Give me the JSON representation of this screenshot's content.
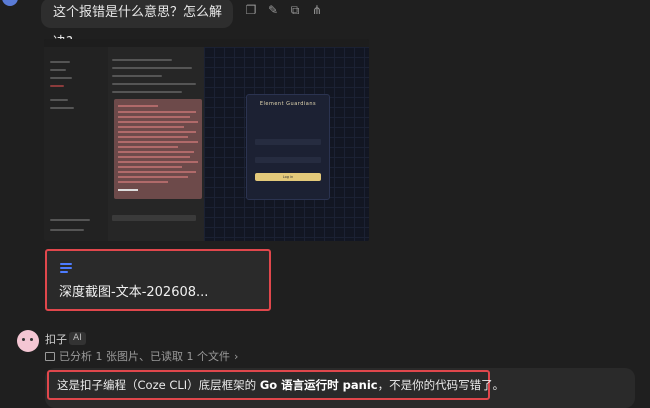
{
  "user_message": {
    "text": "这个报错是什么意思？怎么解决?"
  },
  "message_actions": [
    "bookmark-icon",
    "edit-icon",
    "copy-icon",
    "share-icon"
  ],
  "attachment": {
    "screenshot": {
      "login_title": "Element Guardians",
      "login_button": "Log in"
    },
    "file": {
      "name": "深度截图-文本-202608..."
    }
  },
  "bot": {
    "name": "扣子",
    "badge": "AI",
    "analysis": "已分析 1 张图片、已读取 1 个文件",
    "answer": {
      "prefix": "这是扣子编程（Coze CLI）底层框架的 ",
      "bold": "Go 语言运行时 panic",
      "suffix": "，不是你的代码写错了。"
    }
  },
  "colors": {
    "background": "#1f1f1f",
    "highlight_border": "#e0474c",
    "doc_icon": "#4d7cff"
  }
}
